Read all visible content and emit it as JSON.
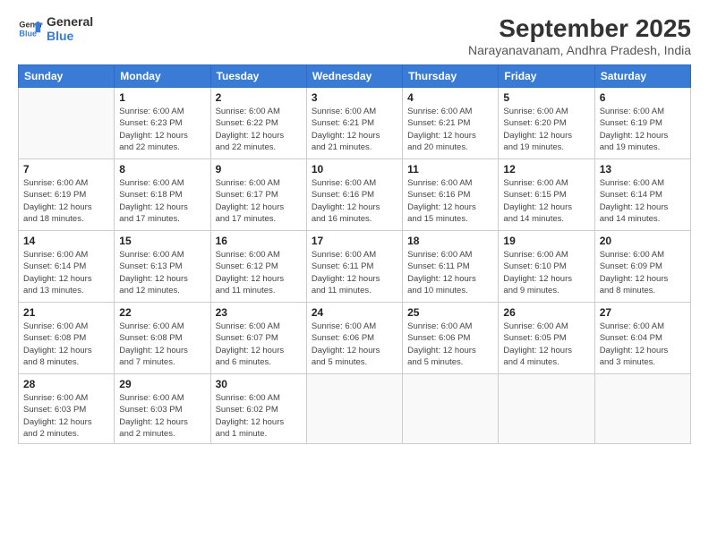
{
  "logo": {
    "line1": "General",
    "line2": "Blue"
  },
  "title": "September 2025",
  "location": "Narayanavanam, Andhra Pradesh, India",
  "days_of_week": [
    "Sunday",
    "Monday",
    "Tuesday",
    "Wednesday",
    "Thursday",
    "Friday",
    "Saturday"
  ],
  "weeks": [
    [
      {
        "day": "",
        "info": ""
      },
      {
        "day": "1",
        "info": "Sunrise: 6:00 AM\nSunset: 6:23 PM\nDaylight: 12 hours\nand 22 minutes."
      },
      {
        "day": "2",
        "info": "Sunrise: 6:00 AM\nSunset: 6:22 PM\nDaylight: 12 hours\nand 22 minutes."
      },
      {
        "day": "3",
        "info": "Sunrise: 6:00 AM\nSunset: 6:21 PM\nDaylight: 12 hours\nand 21 minutes."
      },
      {
        "day": "4",
        "info": "Sunrise: 6:00 AM\nSunset: 6:21 PM\nDaylight: 12 hours\nand 20 minutes."
      },
      {
        "day": "5",
        "info": "Sunrise: 6:00 AM\nSunset: 6:20 PM\nDaylight: 12 hours\nand 19 minutes."
      },
      {
        "day": "6",
        "info": "Sunrise: 6:00 AM\nSunset: 6:19 PM\nDaylight: 12 hours\nand 19 minutes."
      }
    ],
    [
      {
        "day": "7",
        "info": "Sunrise: 6:00 AM\nSunset: 6:19 PM\nDaylight: 12 hours\nand 18 minutes."
      },
      {
        "day": "8",
        "info": "Sunrise: 6:00 AM\nSunset: 6:18 PM\nDaylight: 12 hours\nand 17 minutes."
      },
      {
        "day": "9",
        "info": "Sunrise: 6:00 AM\nSunset: 6:17 PM\nDaylight: 12 hours\nand 17 minutes."
      },
      {
        "day": "10",
        "info": "Sunrise: 6:00 AM\nSunset: 6:16 PM\nDaylight: 12 hours\nand 16 minutes."
      },
      {
        "day": "11",
        "info": "Sunrise: 6:00 AM\nSunset: 6:16 PM\nDaylight: 12 hours\nand 15 minutes."
      },
      {
        "day": "12",
        "info": "Sunrise: 6:00 AM\nSunset: 6:15 PM\nDaylight: 12 hours\nand 14 minutes."
      },
      {
        "day": "13",
        "info": "Sunrise: 6:00 AM\nSunset: 6:14 PM\nDaylight: 12 hours\nand 14 minutes."
      }
    ],
    [
      {
        "day": "14",
        "info": "Sunrise: 6:00 AM\nSunset: 6:14 PM\nDaylight: 12 hours\nand 13 minutes."
      },
      {
        "day": "15",
        "info": "Sunrise: 6:00 AM\nSunset: 6:13 PM\nDaylight: 12 hours\nand 12 minutes."
      },
      {
        "day": "16",
        "info": "Sunrise: 6:00 AM\nSunset: 6:12 PM\nDaylight: 12 hours\nand 11 minutes."
      },
      {
        "day": "17",
        "info": "Sunrise: 6:00 AM\nSunset: 6:11 PM\nDaylight: 12 hours\nand 11 minutes."
      },
      {
        "day": "18",
        "info": "Sunrise: 6:00 AM\nSunset: 6:11 PM\nDaylight: 12 hours\nand 10 minutes."
      },
      {
        "day": "19",
        "info": "Sunrise: 6:00 AM\nSunset: 6:10 PM\nDaylight: 12 hours\nand 9 minutes."
      },
      {
        "day": "20",
        "info": "Sunrise: 6:00 AM\nSunset: 6:09 PM\nDaylight: 12 hours\nand 8 minutes."
      }
    ],
    [
      {
        "day": "21",
        "info": "Sunrise: 6:00 AM\nSunset: 6:08 PM\nDaylight: 12 hours\nand 8 minutes."
      },
      {
        "day": "22",
        "info": "Sunrise: 6:00 AM\nSunset: 6:08 PM\nDaylight: 12 hours\nand 7 minutes."
      },
      {
        "day": "23",
        "info": "Sunrise: 6:00 AM\nSunset: 6:07 PM\nDaylight: 12 hours\nand 6 minutes."
      },
      {
        "day": "24",
        "info": "Sunrise: 6:00 AM\nSunset: 6:06 PM\nDaylight: 12 hours\nand 5 minutes."
      },
      {
        "day": "25",
        "info": "Sunrise: 6:00 AM\nSunset: 6:06 PM\nDaylight: 12 hours\nand 5 minutes."
      },
      {
        "day": "26",
        "info": "Sunrise: 6:00 AM\nSunset: 6:05 PM\nDaylight: 12 hours\nand 4 minutes."
      },
      {
        "day": "27",
        "info": "Sunrise: 6:00 AM\nSunset: 6:04 PM\nDaylight: 12 hours\nand 3 minutes."
      }
    ],
    [
      {
        "day": "28",
        "info": "Sunrise: 6:00 AM\nSunset: 6:03 PM\nDaylight: 12 hours\nand 2 minutes."
      },
      {
        "day": "29",
        "info": "Sunrise: 6:00 AM\nSunset: 6:03 PM\nDaylight: 12 hours\nand 2 minutes."
      },
      {
        "day": "30",
        "info": "Sunrise: 6:00 AM\nSunset: 6:02 PM\nDaylight: 12 hours\nand 1 minute."
      },
      {
        "day": "",
        "info": ""
      },
      {
        "day": "",
        "info": ""
      },
      {
        "day": "",
        "info": ""
      },
      {
        "day": "",
        "info": ""
      }
    ]
  ]
}
